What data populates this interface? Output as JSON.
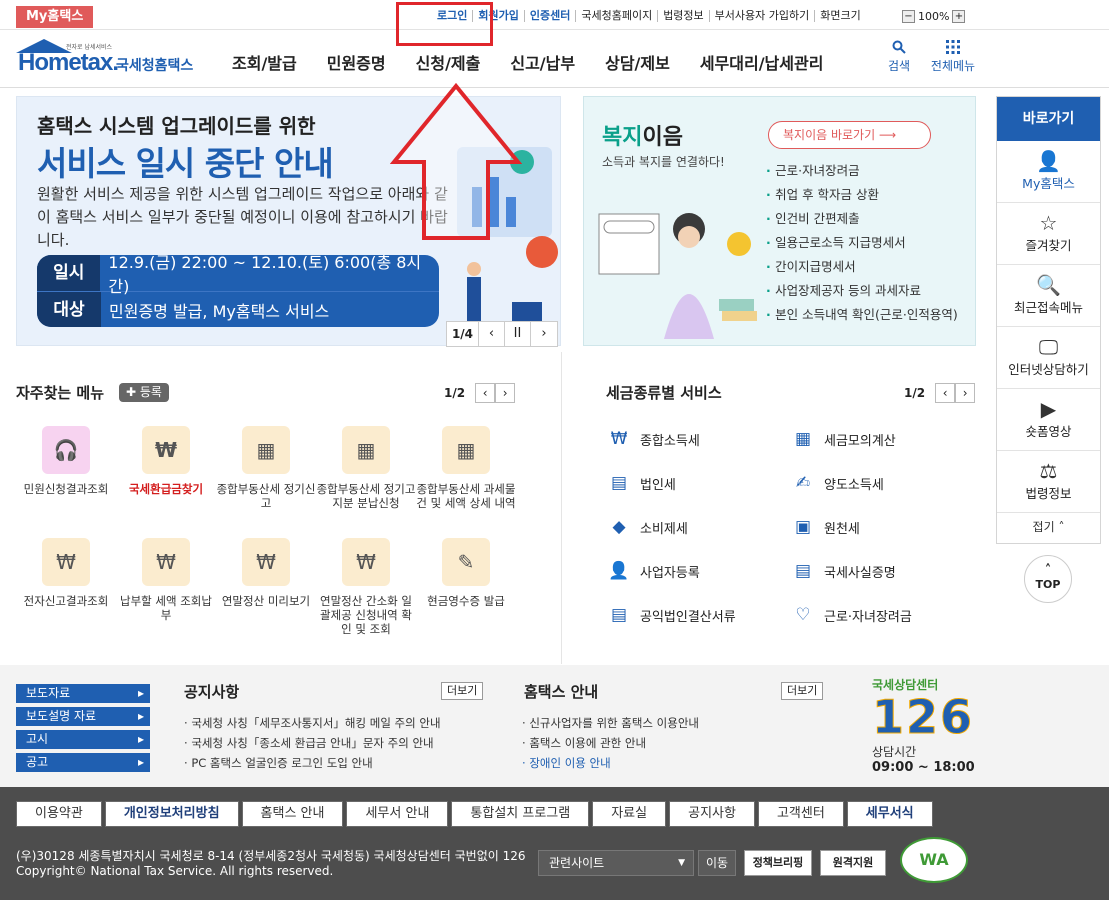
{
  "topbar": {
    "myhome_tab": "My홈택스",
    "util_links": [
      "로그인",
      "회원가입",
      "인증센터",
      "국세청홈페이지",
      "법령정보",
      "부서사용자 가입하기",
      "화면크기"
    ],
    "zoom": "100%",
    "zoom_minus": "−",
    "zoom_plus": "+"
  },
  "header": {
    "logo_home": "Hometax.",
    "logo_kr": "국세청홈택스",
    "logo_sub": "전자로 납세서비스",
    "nav": [
      "조회/발급",
      "민원증명",
      "신청/제출",
      "신고/납부",
      "상담/제보",
      "세무대리/납세관리"
    ],
    "search_label": "검색",
    "allmenu_label": "전체메뉴"
  },
  "banner": {
    "title_small": "홈택스 시스템 업그레이드를 위한",
    "title_big": "서비스 일시 중단 안내",
    "desc": "원활한 서비스 제공을 위한 시스템 업그레이드 작업으로 아래와 같이 홈택스 서비스 일부가 중단될 예정이니 이용에 참고하시기 바랍니다.",
    "rows": [
      {
        "k": "일시",
        "v": "12.9.(금) 22:00 ~ 12.10.(토) 6:00(총 8시간)"
      },
      {
        "k": "대상",
        "v": "민원증명 발급, My홈택스 서비스"
      }
    ],
    "page": "1/4",
    "prev": "‹",
    "pause": "II",
    "next": "›"
  },
  "welfare": {
    "title_green": "복지",
    "title_rest": "이음",
    "subtitle": "소득과 복지를 연결하다!",
    "go_button": "복지이음 바로가기 ⟶",
    "items": [
      "근로·자녀장려금",
      "취업 후 학자금 상환",
      "인건비 간편제출",
      "일용근로소득 지급명세서",
      "간이지급명세서",
      "사업장제공자 등의 과세자료",
      "본인 소득내역 확인(근로·인적용역)"
    ]
  },
  "quick": {
    "header": "바로가기",
    "items": [
      {
        "label": "My홈택스",
        "icon": "👤"
      },
      {
        "label": "즐겨찾기",
        "icon": "☆"
      },
      {
        "label": "최근접속메뉴",
        "icon": "🔍"
      },
      {
        "label": "인터넷상담하기",
        "icon": "🖵"
      },
      {
        "label": "숏폼영상",
        "icon": "▶"
      },
      {
        "label": "법령정보",
        "icon": "⚖"
      }
    ],
    "fold": "접기 ˄",
    "top": "TOP"
  },
  "freq": {
    "title": "자주찾는 메뉴",
    "register": "✚ 등록",
    "page": "1/2",
    "items": [
      {
        "label": "민원신청결과조회",
        "icon": "🎧"
      },
      {
        "label": "국세환급금찾기",
        "icon": "₩"
      },
      {
        "label": "종합부동산세 정기신고",
        "icon": "▦"
      },
      {
        "label": "종합부동산세 정기고지분 분납신청",
        "icon": "▦"
      },
      {
        "label": "종합부동산세 과세물건 및 세액 상세 내역",
        "icon": "▦"
      },
      {
        "label": "전자신고결과조회",
        "icon": "₩"
      },
      {
        "label": "납부할 세액 조회납부",
        "icon": "₩"
      },
      {
        "label": "연말정산 미리보기",
        "icon": "₩"
      },
      {
        "label": "연말정산 간소화 일괄제공 신청내역 확인 및 조회",
        "icon": "₩"
      },
      {
        "label": "현금영수증 발급",
        "icon": "✎"
      }
    ]
  },
  "taxsvc": {
    "title": "세금종류별 서비스",
    "page": "1/2",
    "items": [
      {
        "label": "종합소득세",
        "icon": "₩"
      },
      {
        "label": "세금모의계산",
        "icon": "▦"
      },
      {
        "label": "법인세",
        "icon": "▤"
      },
      {
        "label": "양도소득세",
        "icon": "✍"
      },
      {
        "label": "소비제세",
        "icon": "◆"
      },
      {
        "label": "원천세",
        "icon": "▣"
      },
      {
        "label": "사업자등록",
        "icon": "👤"
      },
      {
        "label": "국세사실증명",
        "icon": "▤"
      },
      {
        "label": "공익법인결산서류",
        "icon": "▤"
      },
      {
        "label": "근로·자녀장려금",
        "icon": "♡"
      }
    ]
  },
  "notice": {
    "side_links": [
      "보도자료",
      "보도설명 자료",
      "고시",
      "공고"
    ],
    "notice_title": "공지사항",
    "notice_more": "더보기",
    "notice_items": [
      "국세청 사칭「세무조사통지서」해킹 메일 주의 안내",
      "국세청 사칭「종소세 환급금 안내」문자 주의 안내",
      "PC 홈택스 얼굴인증 로그인 도입 안내"
    ],
    "guide_title": "홈택스 안내",
    "guide_more": "더보기",
    "guide_items": [
      "신규사업자를 위한 홈택스 이용안내",
      "홈택스 이용에 관한 안내",
      "장애인 이용 안내"
    ],
    "center_title": "국세상담센터",
    "center_number": "126",
    "center_hours_label": "상담시간",
    "center_hours": "09:00 ~ 18:00"
  },
  "footer": {
    "nav": [
      "이용약관",
      "개인정보처리방침",
      "홈택스 안내",
      "세무서 안내",
      "통합설치 프로그램",
      "자료실",
      "공지사항",
      "고객센터",
      "세무서식"
    ],
    "address": "(우)30128 세종특별자치시 국세청로 8-14 (정부세종2청사 국세청동) 국세청상담센터 국번없이 126",
    "copyright": "Copyright© National Tax Service. All rights reserved.",
    "related_site": "관련사이트",
    "move": "이동",
    "policy": "정책브리핑",
    "remote": "원격지원",
    "wa": "WA"
  },
  "colors": {
    "brand_blue": "#1f5fb1",
    "accent_red": "#e0262b",
    "green": "#0aa08a"
  }
}
